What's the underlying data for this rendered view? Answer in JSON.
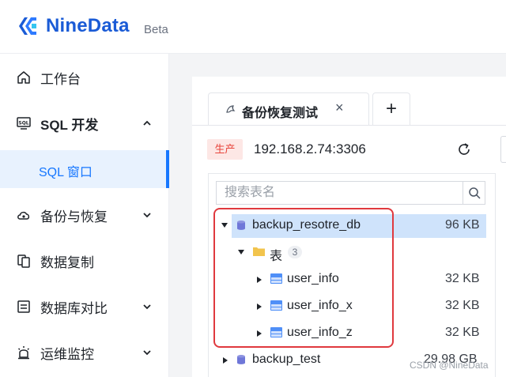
{
  "brand": {
    "name": "NineData",
    "tag": "Beta",
    "color": "#1a5bd6"
  },
  "sidebar": {
    "items": [
      {
        "label": "工作台",
        "icon": "home-icon"
      },
      {
        "label": "SQL 开发",
        "icon": "sql-icon",
        "expanded": true,
        "children": [
          {
            "label": "SQL 窗口",
            "active": true
          }
        ]
      },
      {
        "label": "备份与恢复",
        "icon": "cloud-backup-icon",
        "expanded": false
      },
      {
        "label": "数据复制",
        "icon": "copy-icon"
      },
      {
        "label": "数据库对比",
        "icon": "compare-icon",
        "expanded": false
      },
      {
        "label": "运维监控",
        "icon": "alarm-icon",
        "expanded": false
      }
    ]
  },
  "tabs": [
    {
      "label": "备份恢复测试",
      "icon": "mysql-dolphin-icon",
      "active": true,
      "close": "×"
    }
  ],
  "tab_add": "+",
  "connection": {
    "env": "生产",
    "host": "192.168.2.74:3306"
  },
  "search": {
    "placeholder": "搜索表名"
  },
  "tree": {
    "databases": [
      {
        "name": "backup_resotre_db",
        "size": "96 KB",
        "selected": true,
        "expanded": true,
        "groups": [
          {
            "label": "表",
            "count": "3",
            "expanded": true,
            "tables": [
              {
                "name": "user_info",
                "size": "32 KB"
              },
              {
                "name": "user_info_x",
                "size": "32 KB"
              },
              {
                "name": "user_info_z",
                "size": "32 KB"
              }
            ]
          }
        ]
      },
      {
        "name": "backup_test",
        "size": "29.98 GB",
        "selected": false,
        "expanded": false
      }
    ]
  },
  "watermark": "CSDN @NineData",
  "colors": {
    "accent": "#1677ff",
    "env_badge_bg": "#fde7e5",
    "env_badge_text": "#e8453c",
    "annotation": "#e0393e"
  }
}
